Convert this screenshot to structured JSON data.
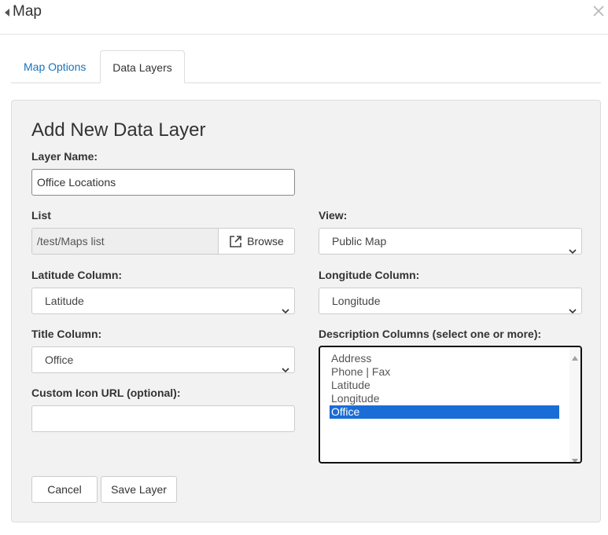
{
  "header": {
    "title": "Map",
    "back_icon": "caret-left-icon",
    "close_icon": "close-icon"
  },
  "tabs": [
    {
      "label": "Map Options",
      "active": false
    },
    {
      "label": "Data Layers",
      "active": true
    }
  ],
  "form": {
    "title": "Add New Data Layer",
    "layer_name": {
      "label": "Layer Name:",
      "value": "Office Locations"
    },
    "list": {
      "label": "List",
      "value": "/test/Maps list",
      "browse_label": "Browse",
      "browse_icon": "external-link-icon"
    },
    "view": {
      "label": "View:",
      "selected": "Public Map"
    },
    "latitude_column": {
      "label": "Latitude Column:",
      "selected": "Latitude"
    },
    "longitude_column": {
      "label": "Longitude Column:",
      "selected": "Longitude"
    },
    "title_column": {
      "label": "Title Column:",
      "selected": "Office"
    },
    "description_columns": {
      "label": "Description Columns (select one or more):",
      "options": [
        "Address",
        "Phone | Fax",
        "Latitude",
        "Longitude",
        "Office"
      ],
      "selected": [
        "Office"
      ]
    },
    "custom_icon_url": {
      "label": "Custom Icon URL (optional):",
      "value": ""
    }
  },
  "buttons": {
    "cancel": "Cancel",
    "save": "Save Layer"
  },
  "colors": {
    "link": "#1a73b8",
    "selection": "#1a6dd6",
    "panel_bg": "#f2f2f2",
    "border": "#cccccc"
  }
}
